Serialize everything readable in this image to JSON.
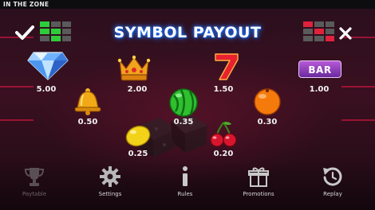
{
  "title_bar": {
    "text": "IN THE ZONE"
  },
  "heading": {
    "text": "SYMBOL PAYOUT"
  },
  "symbols": [
    {
      "name": "diamond",
      "payout": "5.00"
    },
    {
      "name": "crown",
      "payout": "2.00"
    },
    {
      "name": "seven",
      "payout": "1.50"
    },
    {
      "name": "bar",
      "label": "BAR",
      "payout": "1.00"
    },
    {
      "name": "bell",
      "payout": "0.50"
    },
    {
      "name": "watermelon",
      "payout": "0.35"
    },
    {
      "name": "orange",
      "payout": "0.30"
    },
    {
      "name": "lemon",
      "payout": "0.25"
    },
    {
      "name": "cherries",
      "payout": "0.20"
    }
  ],
  "nav": [
    {
      "id": "paytable",
      "label": "Paytable",
      "icon": "trophy-icon",
      "active": false
    },
    {
      "id": "settings",
      "label": "Settings",
      "icon": "gear-icon",
      "active": true
    },
    {
      "id": "rules",
      "label": "Rules",
      "icon": "info-icon",
      "active": true
    },
    {
      "id": "promotions",
      "label": "Promotions",
      "icon": "gift-icon",
      "active": true
    },
    {
      "id": "replay",
      "label": "Replay",
      "icon": "replay-icon",
      "active": true
    }
  ],
  "colors": {
    "accent_green": "#2fcc3a",
    "accent_red": "#e0223c",
    "heading_glow": "#2b7cff",
    "background": "#2a0f1e"
  }
}
